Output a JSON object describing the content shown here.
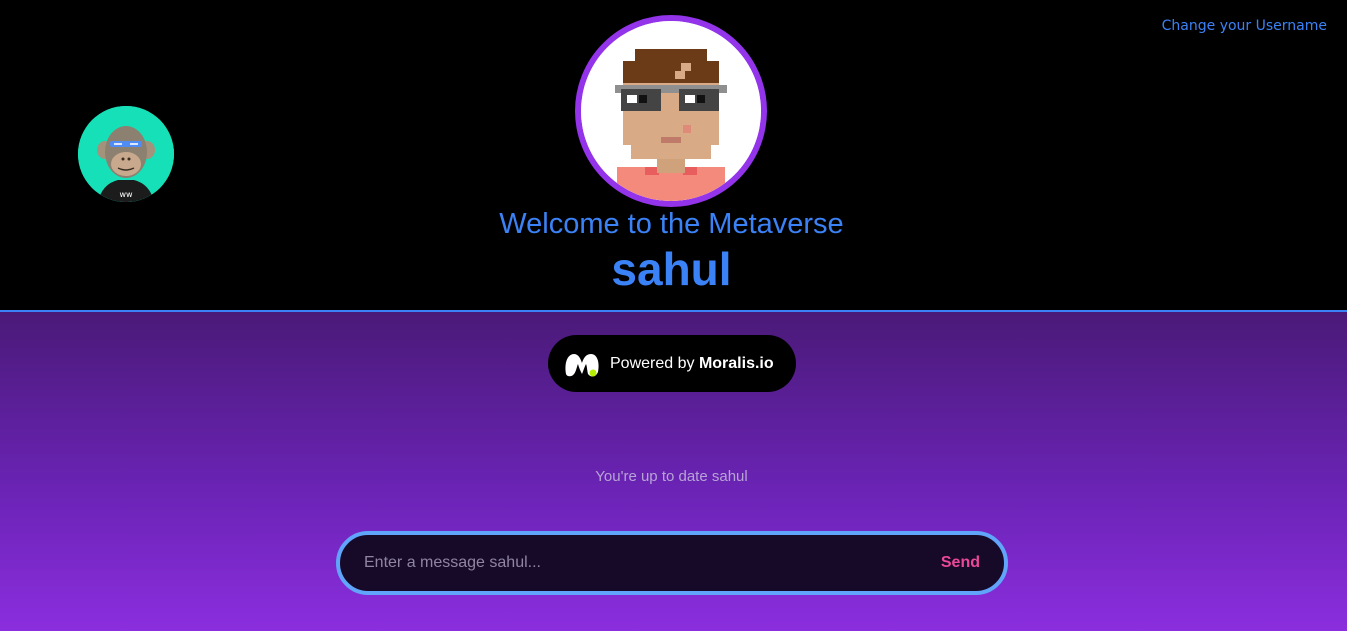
{
  "header": {
    "change_username_link": "Change your Username",
    "welcome_text": "Welcome to the Metaverse",
    "username": "sahul",
    "main_avatar_icon": "pixel-character-avatar-icon",
    "side_avatar_icon": "bored-ape-avatar-icon"
  },
  "powered_by": {
    "prefix": "Powered by",
    "brand": "Moralis.io",
    "logo_icon": "moralis-logo-icon"
  },
  "chat": {
    "status_text": "You're up to date sahul",
    "input_placeholder": "Enter a message sahul...",
    "input_value": "",
    "send_label": "Send"
  },
  "colors": {
    "accent_blue": "#3b82f6",
    "avatar_ring": "#9333ea",
    "send_pink": "#ec4899",
    "composer_border": "#60a5fa"
  }
}
